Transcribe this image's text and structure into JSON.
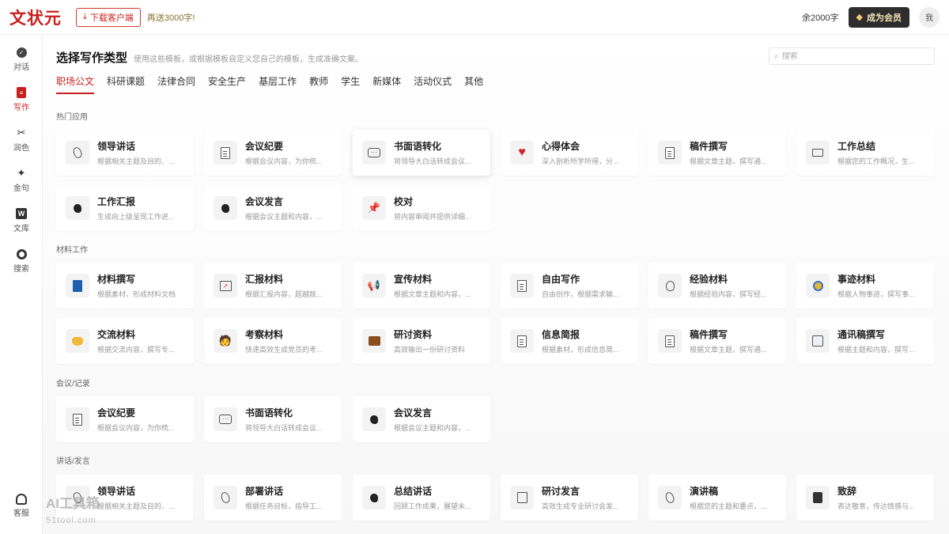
{
  "header": {
    "logo": "文状元",
    "download_label": "下载客户端",
    "promo": "再送3000字!",
    "balance": "余2000字",
    "vip_label": "成为会员",
    "avatar_text": "我"
  },
  "sidebar": {
    "items": [
      {
        "label": "对话",
        "icon": "chat-icon"
      },
      {
        "label": "写作",
        "icon": "write-doc-icon"
      },
      {
        "label": "润色",
        "icon": "polish-icon"
      },
      {
        "label": "金句",
        "icon": "sparkle-icon"
      },
      {
        "label": "文库",
        "icon": "library-w-icon"
      },
      {
        "label": "搜索",
        "icon": "search-icon"
      }
    ],
    "support_label": "客服"
  },
  "main": {
    "title": "选择写作类型",
    "subtitle": "使用这些模板，或根据模板自定义您自己的模板，生成准确文案。",
    "search_placeholder": "搜索",
    "tabs": [
      "职场公文",
      "科研课题",
      "法律合同",
      "安全生产",
      "基层工作",
      "教师",
      "学生",
      "新媒体",
      "活动仪式",
      "其他"
    ],
    "sections": [
      {
        "label": "热门应用",
        "cards": [
          {
            "title": "领导讲话",
            "desc": "根据相关主题及目的、...",
            "icon": "speech-leaf-icon"
          },
          {
            "title": "会议纪要",
            "desc": "根据会议内容，为你梳...",
            "icon": "document-icon"
          },
          {
            "title": "书面语转化",
            "desc": "将领导大白话转成会议...",
            "icon": "chat-bubble-icon"
          },
          {
            "title": "心得体会",
            "desc": "深入剖析所学所得，分...",
            "icon": "heart-icon"
          },
          {
            "title": "稿件撰写",
            "desc": "根据文章主题，撰写通...",
            "icon": "document-icon"
          },
          {
            "title": "工作总结",
            "desc": "根据您的工作概况，生...",
            "icon": "laptop-icon"
          },
          {
            "title": "工作汇报",
            "desc": "生成向上级呈现工作进...",
            "icon": "speaking-head-icon"
          },
          {
            "title": "会议发言",
            "desc": "根据会议主题和内容，...",
            "icon": "speaking-head-icon"
          },
          {
            "title": "校对",
            "desc": "将内容审阅并提供详细...",
            "icon": "pushpin-icon"
          }
        ]
      },
      {
        "label": "材料工作",
        "cards": [
          {
            "title": "材料撰写",
            "desc": "根据素材，形成材料文档",
            "icon": "blue-book-icon"
          },
          {
            "title": "汇报材料",
            "desc": "根据汇报内容，超越既...",
            "icon": "chart-icon"
          },
          {
            "title": "宣传材料",
            "desc": "根据文章主题和内容，...",
            "icon": "megaphone-icon"
          },
          {
            "title": "自由写作",
            "desc": "自由创作，根据需求输...",
            "icon": "document-icon"
          },
          {
            "title": "经验材料",
            "desc": "根据经验内容，撰写经...",
            "icon": "lightbulb-icon"
          },
          {
            "title": "事迹材料",
            "desc": "根据人物事迹，撰写事...",
            "icon": "medal-icon"
          },
          {
            "title": "交流材料",
            "desc": "根据交流内容，撰写专...",
            "icon": "handshake-icon"
          },
          {
            "title": "考察材料",
            "desc": "快速高效生成党员的考...",
            "icon": "face-laptop-icon"
          },
          {
            "title": "研讨资料",
            "desc": "高效输出一份研讨资料",
            "icon": "briefcase-icon"
          },
          {
            "title": "信息简报",
            "desc": "根据素材，形成信息简...",
            "icon": "document-icon"
          },
          {
            "title": "稿件撰写",
            "desc": "根据文章主题，撰写通...",
            "icon": "document-icon"
          },
          {
            "title": "通讯稿撰写",
            "desc": "根据主题和内容，撰写...",
            "icon": "newspaper-icon"
          }
        ]
      },
      {
        "label": "会议/记录",
        "cards": [
          {
            "title": "会议纪要",
            "desc": "根据会议内容，为你梳...",
            "icon": "document-icon"
          },
          {
            "title": "书面语转化",
            "desc": "将领导大白话转成会议...",
            "icon": "chat-bubble-icon"
          },
          {
            "title": "会议发言",
            "desc": "根据会议主题和内容，...",
            "icon": "speaking-head-icon"
          }
        ]
      },
      {
        "label": "讲话/发言",
        "cards": [
          {
            "title": "领导讲话",
            "desc": "根据相关主题及目的、...",
            "icon": "speech-leaf-icon"
          },
          {
            "title": "部署讲话",
            "desc": "根据任务目标，指导工...",
            "icon": "speech-leaf-icon"
          },
          {
            "title": "总结讲话",
            "desc": "回顾工作成果，展望未...",
            "icon": "speaking-head-icon"
          },
          {
            "title": "研讨发言",
            "desc": "高效生成专业研讨会发...",
            "icon": "memo-icon"
          },
          {
            "title": "演讲稿",
            "desc": "根据您的主题和要点，...",
            "icon": "speech-leaf-icon"
          },
          {
            "title": "致辞",
            "desc": "表达敬意，传达情感与...",
            "icon": "person-icon"
          }
        ]
      }
    ]
  },
  "watermark": {
    "text": "AI工具箱",
    "sub": "51tool.com"
  }
}
